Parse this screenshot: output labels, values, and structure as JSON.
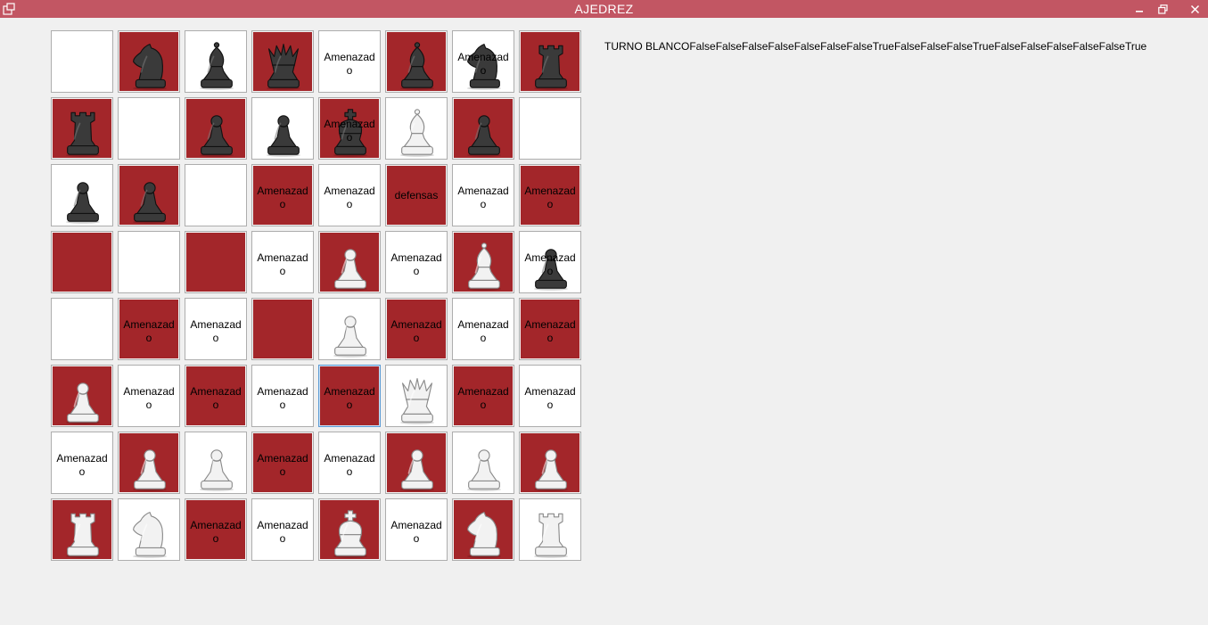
{
  "window": {
    "title": "AJEDREZ"
  },
  "status_label": "TURNO BLANCOFalseFalseFalseFalseFalseFalseFalseTrueFalseFalseFalseTrueFalseFalseFalseFalseFalseTrue",
  "colors": {
    "dark_square": "#a3262a",
    "light_square": "#ffffff",
    "titlebar": "#c25663"
  },
  "board": [
    [
      {
        "piece": "",
        "text": ""
      },
      {
        "piece": "black-knight",
        "text": ""
      },
      {
        "piece": "black-bishop",
        "text": ""
      },
      {
        "piece": "black-queen",
        "text": ""
      },
      {
        "piece": "",
        "text": "Amenazad\no"
      },
      {
        "piece": "black-bishop",
        "text": ""
      },
      {
        "piece": "black-knight",
        "text": "Amenazad\no"
      },
      {
        "piece": "black-rook",
        "text": ""
      }
    ],
    [
      {
        "piece": "black-rook",
        "text": ""
      },
      {
        "piece": "",
        "text": ""
      },
      {
        "piece": "black-pawn",
        "text": ""
      },
      {
        "piece": "black-pawn",
        "text": ""
      },
      {
        "piece": "black-king",
        "text": "Amenazad\no"
      },
      {
        "piece": "white-bishop",
        "text": ""
      },
      {
        "piece": "black-pawn",
        "text": ""
      },
      {
        "piece": "",
        "text": ""
      }
    ],
    [
      {
        "piece": "black-pawn",
        "text": ""
      },
      {
        "piece": "black-pawn",
        "text": ""
      },
      {
        "piece": "",
        "text": ""
      },
      {
        "piece": "",
        "text": "Amenazad\no"
      },
      {
        "piece": "",
        "text": "Amenazad\no"
      },
      {
        "piece": "",
        "text": "defensas"
      },
      {
        "piece": "",
        "text": "Amenazad\no"
      },
      {
        "piece": "",
        "text": "Amenazad\no"
      }
    ],
    [
      {
        "piece": "",
        "text": ""
      },
      {
        "piece": "",
        "text": ""
      },
      {
        "piece": "",
        "text": ""
      },
      {
        "piece": "",
        "text": "Amenazad\no"
      },
      {
        "piece": "white-pawn",
        "text": ""
      },
      {
        "piece": "",
        "text": "Amenazad\no"
      },
      {
        "piece": "white-bishop",
        "text": ""
      },
      {
        "piece": "black-pawn",
        "text": "Amenazad\no"
      }
    ],
    [
      {
        "piece": "",
        "text": ""
      },
      {
        "piece": "",
        "text": "Amenazad\no"
      },
      {
        "piece": "",
        "text": "Amenazad\no"
      },
      {
        "piece": "",
        "text": ""
      },
      {
        "piece": "white-pawn",
        "text": ""
      },
      {
        "piece": "",
        "text": "Amenazad\no"
      },
      {
        "piece": "",
        "text": "Amenazad\no"
      },
      {
        "piece": "",
        "text": "Amenazad\no"
      }
    ],
    [
      {
        "piece": "white-pawn",
        "text": ""
      },
      {
        "piece": "",
        "text": "Amenazad\no"
      },
      {
        "piece": "",
        "text": "Amenazad\no"
      },
      {
        "piece": "",
        "text": "Amenazad\no"
      },
      {
        "piece": "",
        "text": "Amenazad\no"
      },
      {
        "piece": "white-queen",
        "text": ""
      },
      {
        "piece": "",
        "text": "Amenazad\no"
      },
      {
        "piece": "",
        "text": "Amenazad\no"
      }
    ],
    [
      {
        "piece": "",
        "text": "Amenazad\no"
      },
      {
        "piece": "white-pawn",
        "text": ""
      },
      {
        "piece": "white-pawn",
        "text": ""
      },
      {
        "piece": "",
        "text": "Amenazad\no"
      },
      {
        "piece": "",
        "text": "Amenazad\no"
      },
      {
        "piece": "white-pawn",
        "text": ""
      },
      {
        "piece": "white-pawn",
        "text": ""
      },
      {
        "piece": "white-pawn",
        "text": ""
      }
    ],
    [
      {
        "piece": "white-rook",
        "text": ""
      },
      {
        "piece": "white-knight",
        "text": ""
      },
      {
        "piece": "",
        "text": "Amenazad\no"
      },
      {
        "piece": "",
        "text": "Amenazad\no"
      },
      {
        "piece": "white-king",
        "text": ""
      },
      {
        "piece": "",
        "text": "Amenazad\no"
      },
      {
        "piece": "white-knight",
        "text": ""
      },
      {
        "piece": "white-rook",
        "text": ""
      }
    ]
  ]
}
